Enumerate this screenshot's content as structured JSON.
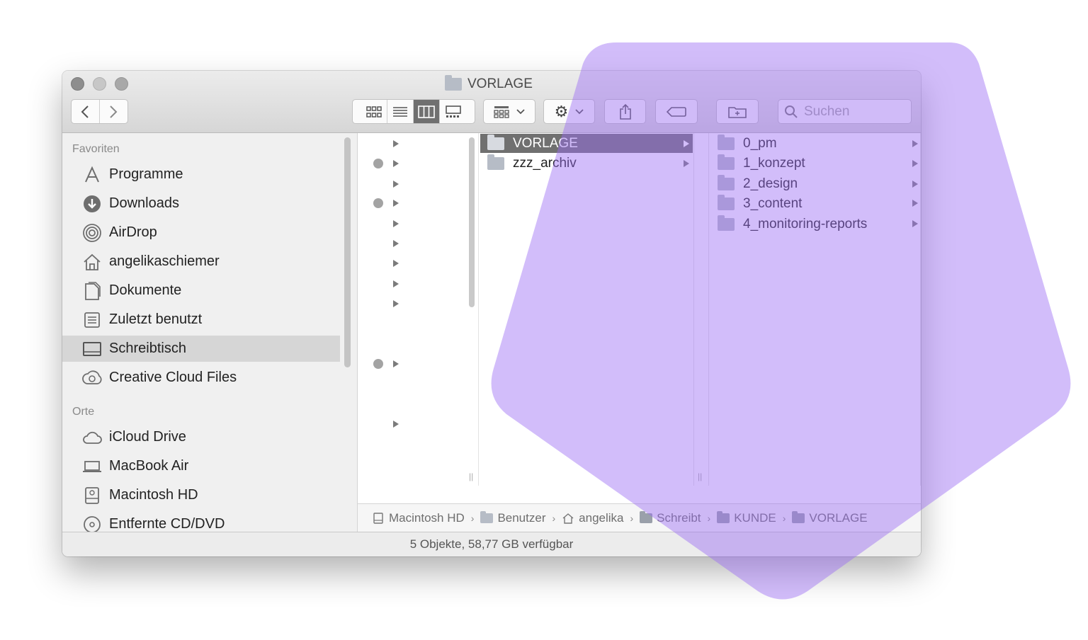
{
  "window": {
    "title": "VORLAGE"
  },
  "toolbar": {
    "search_placeholder": "Suchen",
    "view_icons": [
      "grid-view-icon",
      "list-view-icon",
      "column-view-icon",
      "gallery-view-icon"
    ],
    "active_view": "column-view-icon"
  },
  "sidebar": {
    "favorites_heading": "Favoriten",
    "favorites": [
      {
        "label": "Programme",
        "icon": "applications-icon"
      },
      {
        "label": "Downloads",
        "icon": "downloads-icon"
      },
      {
        "label": "AirDrop",
        "icon": "airdrop-icon"
      },
      {
        "label": "angelikaschiemer",
        "icon": "home-icon"
      },
      {
        "label": "Dokumente",
        "icon": "documents-icon"
      },
      {
        "label": "Zuletzt benutzt",
        "icon": "recents-icon"
      },
      {
        "label": "Schreibtisch",
        "icon": "desktop-icon",
        "selected": true
      },
      {
        "label": "Creative Cloud Files",
        "icon": "creative-cloud-icon"
      }
    ],
    "places_heading": "Orte",
    "places": [
      {
        "label": "iCloud Drive",
        "icon": "cloud-icon"
      },
      {
        "label": "MacBook Air",
        "icon": "laptop-icon"
      },
      {
        "label": "Macintosh HD",
        "icon": "harddisk-icon"
      },
      {
        "label": "Entfernte CD/DVD",
        "icon": "disc-icon"
      }
    ]
  },
  "columns": {
    "column2": [
      {
        "name": "VORLAGE",
        "selected": true
      },
      {
        "name": "zzz_archiv",
        "selected": false
      }
    ],
    "column3": [
      {
        "name": "0_pm"
      },
      {
        "name": "1_konzept"
      },
      {
        "name": "2_design"
      },
      {
        "name": "3_content"
      },
      {
        "name": "4_monitoring-reports"
      }
    ]
  },
  "pathbar": [
    {
      "label": "Macintosh HD",
      "icon": "harddisk-icon"
    },
    {
      "label": "Benutzer",
      "icon": "users-folder-icon"
    },
    {
      "label": "angelika",
      "icon": "home-icon"
    },
    {
      "label": "Schreibt",
      "icon": "folder-icon"
    },
    {
      "label": "KUNDE",
      "icon": "folder-icon"
    },
    {
      "label": "VORLAGE",
      "icon": "folder-icon"
    }
  ],
  "status": {
    "text": "5 Objekte, 58,77 GB verfügbar"
  },
  "colors": {
    "overlay": "#9b6cf5",
    "selection": "#707070"
  }
}
